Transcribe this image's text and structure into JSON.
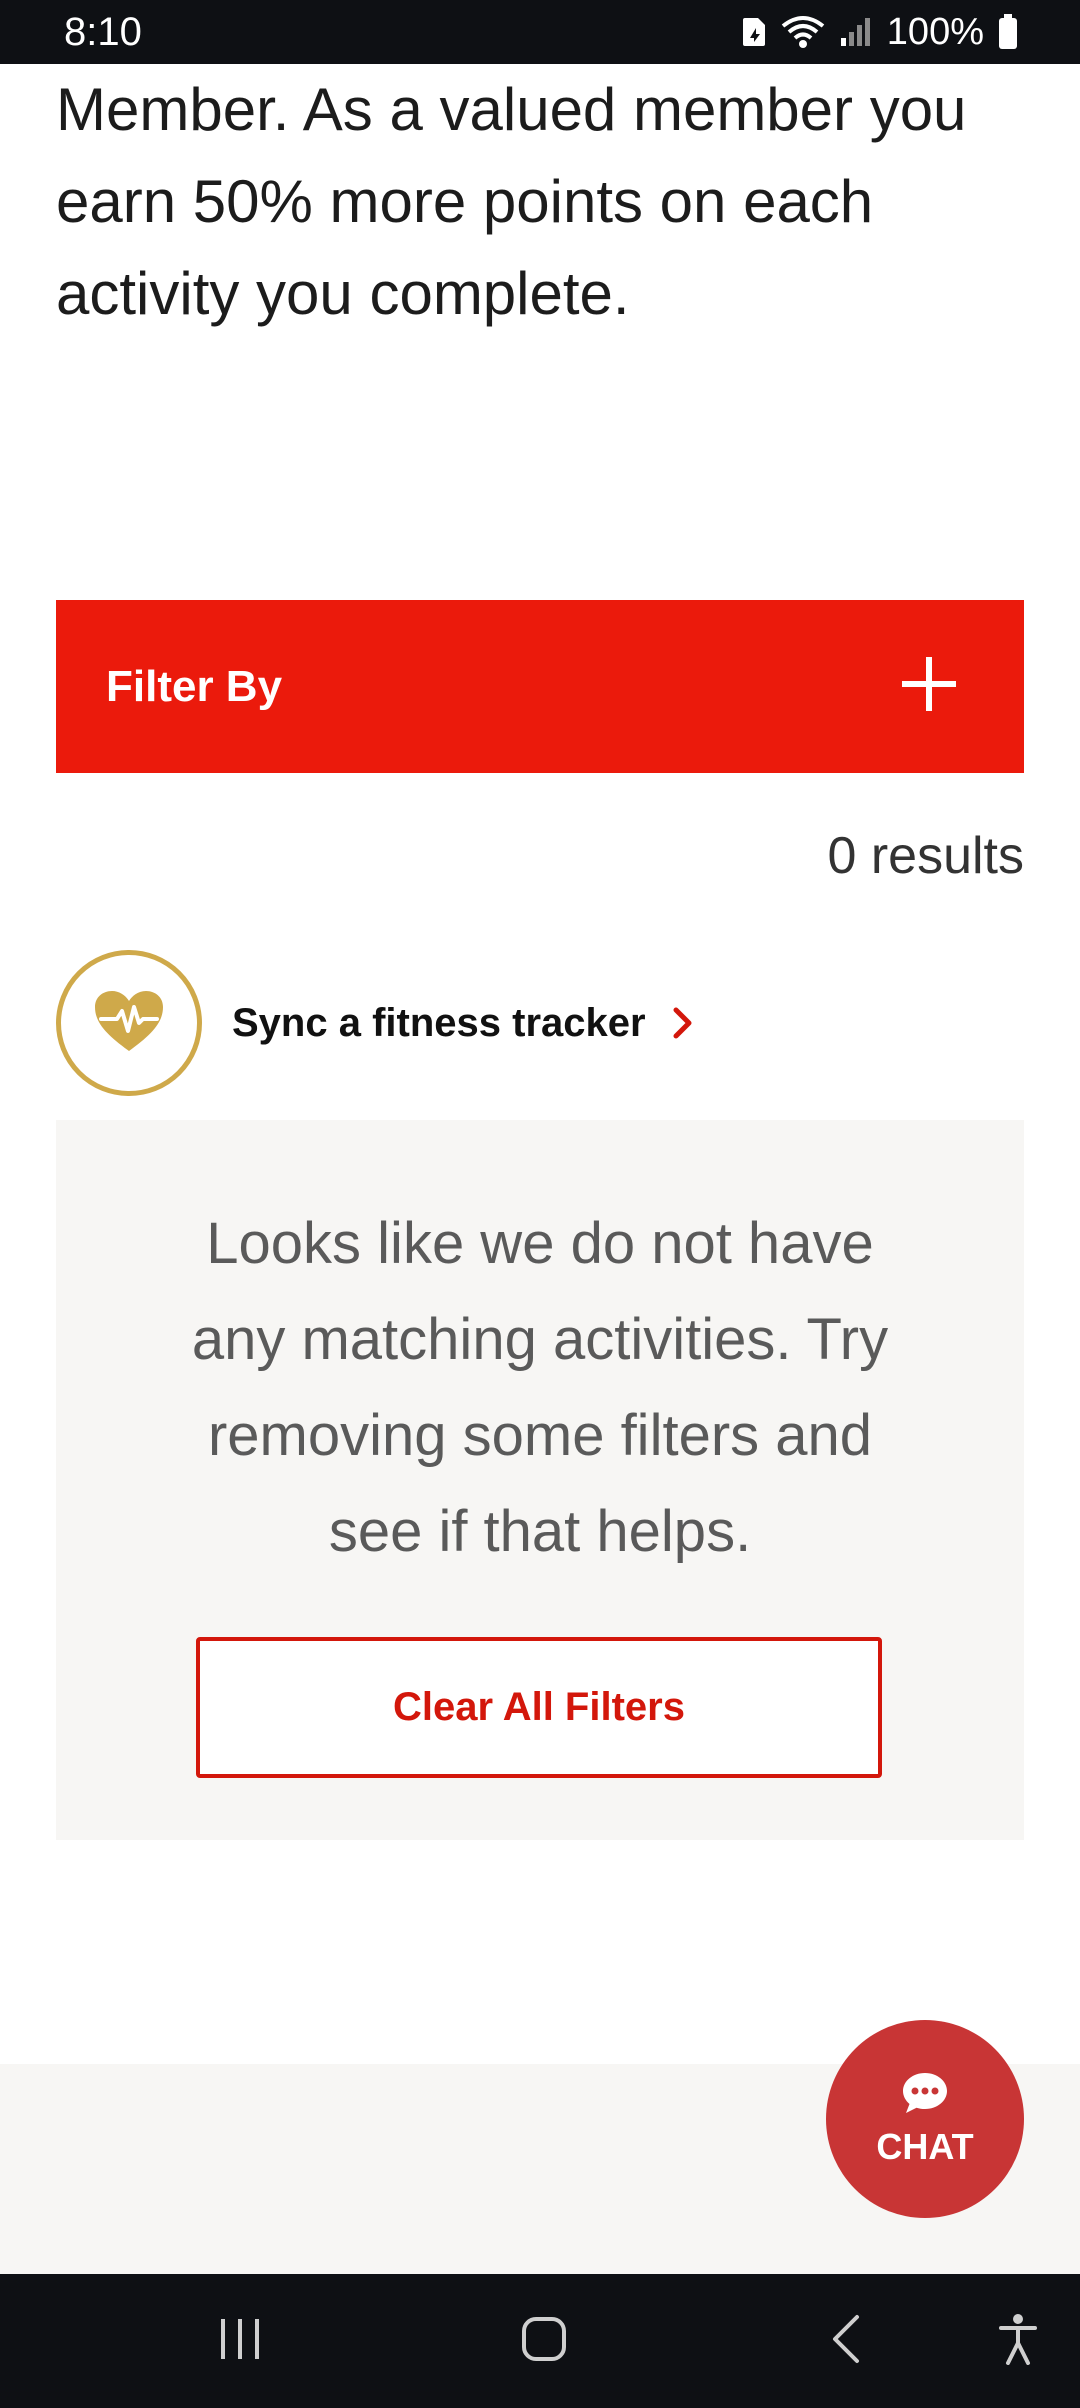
{
  "status_bar": {
    "time": "8:10",
    "battery": "100%",
    "icons": [
      "sim-icon",
      "wifi-icon",
      "signal-icon",
      "battery-icon"
    ]
  },
  "intro": {
    "text": "Member. As a valued member you earn 50% more points on each activity you complete."
  },
  "filter": {
    "label": "Filter By",
    "toggle_icon": "plus-icon"
  },
  "results": {
    "count_text": "0 results"
  },
  "sync_tracker": {
    "label": "Sync a fitness tracker",
    "icon": "heart-pulse-icon",
    "chevron": "chevron-right-icon"
  },
  "empty_state": {
    "message": "Looks like we do not have any matching activities. Try removing some filters and see if that helps.",
    "clear_button": "Clear All Filters"
  },
  "chat": {
    "label": "CHAT",
    "icon": "chat-bubble-icon"
  },
  "nav_bar": {
    "buttons": [
      "recent-apps-icon",
      "home-icon",
      "back-icon",
      "accessibility-icon"
    ]
  },
  "colors": {
    "primary_red": "#eb1a0c",
    "button_red": "#d3170b",
    "chat_red": "#c83535",
    "gold": "#cfa94a",
    "panel_gray": "#f7f6f4",
    "system_bar": "#0e1014"
  }
}
